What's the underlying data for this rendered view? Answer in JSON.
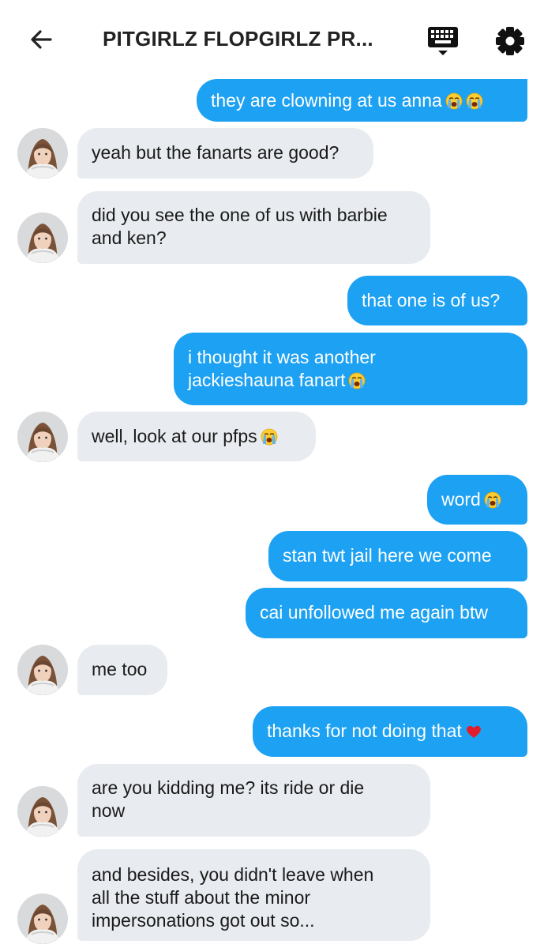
{
  "header": {
    "title": "PITGIRLZ FLOPGIRLZ PR..."
  },
  "icons": {
    "back": "arrow-left-icon",
    "keyboard": "keyboard-icon",
    "settings": "gear-icon",
    "crying": "loudly-crying-face-emoji",
    "heart": "red-heart-emoji"
  },
  "colors": {
    "outgoing_bubble": "#1da1f2",
    "incoming_bubble": "#e8ebef"
  },
  "messages": [
    {
      "from": "me",
      "text": "they are clowning at us anna",
      "emoji": [
        "crying",
        "crying"
      ]
    },
    {
      "from": "them",
      "text": "yeah but the fanarts are good?"
    },
    {
      "from": "them",
      "lines": [
        "did you see the one of us with barbie",
        "and ken?"
      ]
    },
    {
      "from": "me",
      "text": "that one is of us?"
    },
    {
      "from": "me",
      "lines": [
        "i thought it was another",
        "jackieshauna fanart"
      ],
      "emoji": [
        "crying"
      ]
    },
    {
      "from": "them",
      "text": "well, look at our pfps",
      "emoji": [
        "crying"
      ]
    },
    {
      "from": "me",
      "text": "word",
      "emoji": [
        "crying"
      ]
    },
    {
      "from": "me",
      "text": "stan twt jail here we come"
    },
    {
      "from": "me",
      "text": "cai unfollowed me again btw"
    },
    {
      "from": "them",
      "text": "me too"
    },
    {
      "from": "me",
      "text": "thanks for not doing that",
      "emoji": [
        "heart"
      ]
    },
    {
      "from": "them",
      "lines": [
        "are you kidding me? its ride or die",
        "now"
      ]
    },
    {
      "from": "them",
      "lines": [
        "and besides, you didn't leave when",
        "all the stuff about the minor",
        "impersonations got out so..."
      ]
    }
  ]
}
